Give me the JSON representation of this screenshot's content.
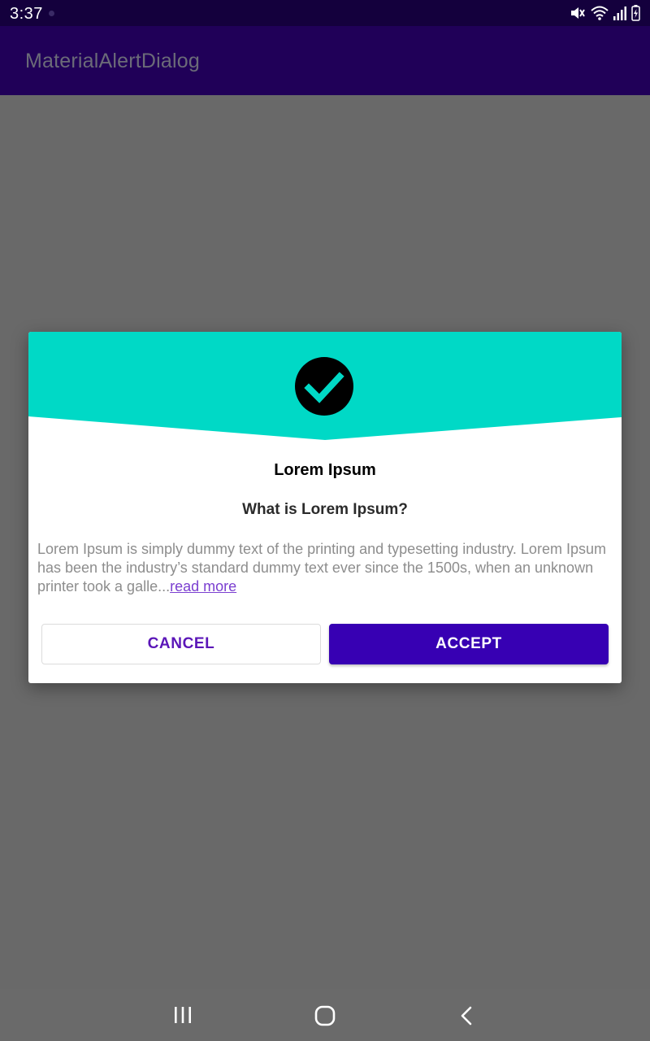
{
  "status_bar": {
    "time": "3:37",
    "icons": [
      "mute-icon",
      "wifi-icon",
      "signal-icon",
      "battery-charging-icon"
    ]
  },
  "app_bar": {
    "title": "MaterialAlertDialog"
  },
  "dialog": {
    "header_color": "#00d9c6",
    "icon": "check-circle-icon",
    "title": "Lorem Ipsum",
    "subtitle": "What is Lorem Ipsum?",
    "body": "Lorem Ipsum is simply dummy text of the printing and typesetting industry. Lorem Ipsum has been the industry’s standard dummy text ever since the 1500s, when an unknown printer took a galle...",
    "read_more": "read more",
    "cancel_label": "CANCEL",
    "accept_label": "ACCEPT",
    "accent_color": "#3700b3"
  },
  "nav_bar": {
    "buttons": [
      "recents-icon",
      "home-icon",
      "back-icon"
    ]
  }
}
